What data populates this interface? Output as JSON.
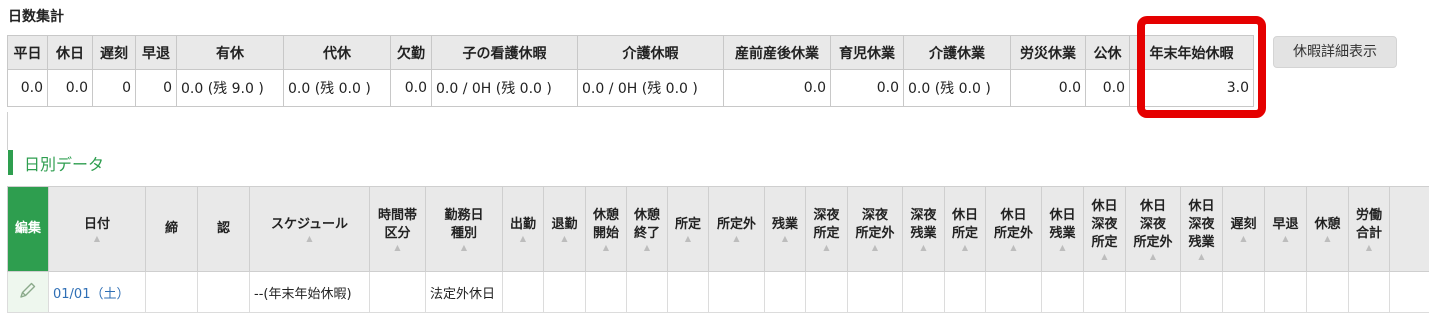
{
  "summary": {
    "title": "日数集計",
    "headers": [
      "平日",
      "休日",
      "遅刻",
      "早退",
      "有休",
      "代休",
      "欠勤",
      "子の看護休暇",
      "介護休暇",
      "産前産後休業",
      "育児休業",
      "介護休業",
      "労災休業",
      "公休",
      "年末年始休暇"
    ],
    "values": [
      "0.0",
      "0.0",
      "0",
      "0",
      "0.0 (残 9.0 )",
      "0.0 (残 0.0 )",
      "0.0",
      "0.0 / 0H (残 0.0 )",
      "0.0 / 0H (残 0.0 )",
      "0.0",
      "0.0",
      "0.0 (残 0.0 )",
      "0.0",
      "0.0",
      "3.0"
    ],
    "detail_button": "休暇詳細表示"
  },
  "daily": {
    "title": "日別データ",
    "headers": [
      "編集",
      "日付",
      "締",
      "認",
      "スケジュール",
      "時間帯\n区分",
      "勤務日\n種別",
      "出勤",
      "退勤",
      "休憩\n開始",
      "休憩\n終了",
      "所定",
      "所定外",
      "残業",
      "深夜\n所定",
      "深夜\n所定外",
      "深夜\n残業",
      "休日\n所定",
      "休日\n所定外",
      "休日\n残業",
      "休日\n深夜\n所定",
      "休日\n深夜\n所定外",
      "休日\n深夜\n残業",
      "遅刻",
      "早退",
      "休憩",
      "労働\n合計",
      ""
    ],
    "sort_mark": "▲",
    "rows": [
      {
        "edit_icon": "pencil-icon",
        "date": "01/01（土）",
        "schedule": "--(年末年始休暇)",
        "day_type": "法定外休日"
      }
    ]
  }
}
